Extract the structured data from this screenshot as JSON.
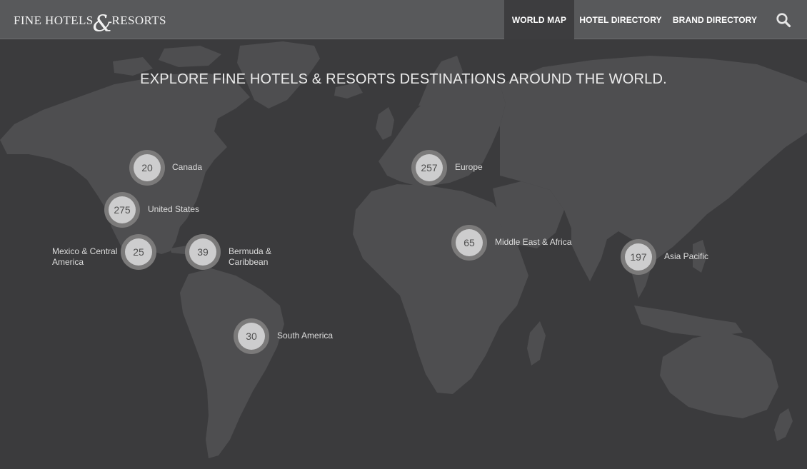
{
  "brand": {
    "logo_left": "FINE HOTELS",
    "logo_amp": "&",
    "logo_right": "RESORTS"
  },
  "nav": {
    "world_map": "WORLD MAP",
    "hotel_directory": "HOTEL DIRECTORY",
    "brand_directory": "BRAND DIRECTORY",
    "search_icon": "search-icon",
    "active": "world_map"
  },
  "headline": "EXPLORE FINE HOTELS & RESORTS DESTINATIONS AROUND THE WORLD.",
  "regions": {
    "canada": {
      "count": "20",
      "label": "Canada"
    },
    "united_states": {
      "count": "275",
      "label": "United States"
    },
    "mexico": {
      "count": "25",
      "label_line1": "Mexico & Central",
      "label_line2": "America"
    },
    "bermuda": {
      "count": "39",
      "label_line1": "Bermuda &",
      "label_line2": "Caribbean"
    },
    "south_america": {
      "count": "30",
      "label": "South America"
    },
    "europe": {
      "count": "257",
      "label": "Europe"
    },
    "middle_east_africa": {
      "count": "65",
      "label": "Middle East & Africa"
    },
    "asia_pacific": {
      "count": "197",
      "label": "Asia Pacific"
    }
  },
  "colors": {
    "nav_bg": "#58595b",
    "active_tab": "#3d3d3f",
    "ocean": "#3b3b3d",
    "land": "#4e4e50",
    "marker_ring": "#7b7a7a",
    "marker_disc": "#cdcdce"
  }
}
